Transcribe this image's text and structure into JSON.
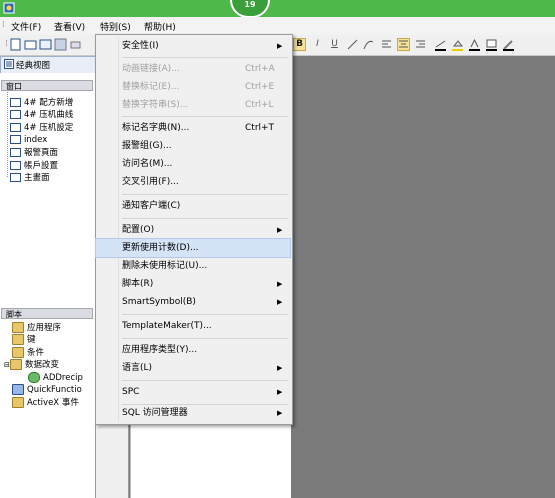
{
  "window": {
    "badge": "19"
  },
  "menubar": [
    {
      "label": "文件(F)"
    },
    {
      "label": "查看(V)"
    },
    {
      "label": "特别(S)"
    },
    {
      "label": "帮助(H)"
    }
  ],
  "toolbar": {
    "bold": "B",
    "italic": "I",
    "underline": "U"
  },
  "left_pane": {
    "tab": "经典视图",
    "window_header": "窗口",
    "windows": [
      "4# 配方新增",
      "4# 压机曲线",
      "4# 压机設定",
      "index",
      "報警頁面",
      "帳戶設置",
      "主畫面"
    ],
    "script_header": "脚本",
    "scripts": [
      "应用程序",
      "键",
      "条件",
      "数据改变",
      "ADDrecip",
      "QuickFunctio",
      "ActiveX 事件"
    ]
  },
  "dropdown": {
    "items": [
      {
        "label": "安全性(I)",
        "shortcut": "",
        "submenu": true,
        "disabled": false
      },
      {
        "label": "动画链接(A)...",
        "shortcut": "Ctrl+A",
        "submenu": false,
        "disabled": true
      },
      {
        "label": "替换标记(E)...",
        "shortcut": "Ctrl+E",
        "submenu": false,
        "disabled": true
      },
      {
        "label": "替换字符串(S)...",
        "shortcut": "Ctrl+L",
        "submenu": false,
        "disabled": true
      },
      {
        "label": "标记名字典(N)...",
        "shortcut": "Ctrl+T",
        "submenu": false,
        "disabled": false
      },
      {
        "label": "报警组(G)...",
        "shortcut": "",
        "submenu": false,
        "disabled": false
      },
      {
        "label": "访问名(M)...",
        "shortcut": "",
        "submenu": false,
        "disabled": false
      },
      {
        "label": "交叉引用(F)...",
        "shortcut": "",
        "submenu": false,
        "disabled": false
      },
      {
        "label": "通知客户端(C)",
        "shortcut": "",
        "submenu": false,
        "disabled": false
      },
      {
        "label": "配置(O)",
        "shortcut": "",
        "submenu": true,
        "disabled": false
      },
      {
        "label": "更新使用计数(D)...",
        "shortcut": "",
        "submenu": false,
        "disabled": false,
        "highlighted": true
      },
      {
        "label": "删除未使用标记(U)...",
        "shortcut": "",
        "submenu": false,
        "disabled": false
      },
      {
        "label": "脚本(R)",
        "shortcut": "",
        "submenu": true,
        "disabled": false
      },
      {
        "label": "SmartSymbol(B)",
        "shortcut": "",
        "submenu": true,
        "disabled": false
      },
      {
        "label": "TemplateMaker(T)...",
        "shortcut": "",
        "submenu": false,
        "disabled": false
      },
      {
        "label": "应用程序类型(Y)...",
        "shortcut": "",
        "submenu": false,
        "disabled": false
      },
      {
        "label": "语言(L)",
        "shortcut": "",
        "submenu": true,
        "disabled": false
      },
      {
        "label": "SPC",
        "shortcut": "",
        "submenu": true,
        "disabled": false
      },
      {
        "label": "SQL 访问管理器",
        "shortcut": "",
        "submenu": true,
        "disabled": false
      }
    ]
  },
  "colors": {
    "title_green": "#4fb84a",
    "highlight": "#d5e3f7",
    "workspace": "#7a7a7a"
  }
}
